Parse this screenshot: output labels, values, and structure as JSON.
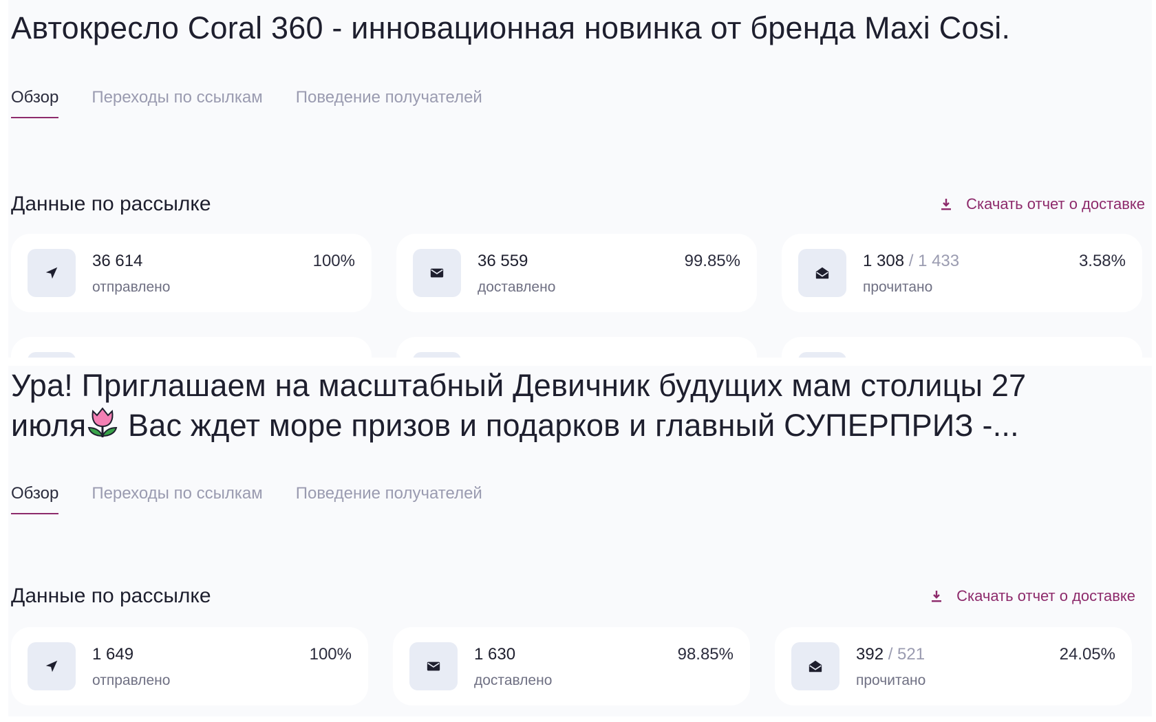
{
  "campaigns": [
    {
      "title_lines": [
        "Автокресло Coral 360 - инновационная новинка от бренда Maxi Cosi."
      ],
      "tabs": [
        "Обзор",
        "Переходы по ссылкам",
        "Поведение получателей"
      ],
      "section_title": "Данные по рассылке",
      "download_label": "Скачать отчет о доставке",
      "stats": [
        {
          "icon": "send-icon",
          "value": "36 614",
          "total": "",
          "caption": "отправлено",
          "percent": "100%"
        },
        {
          "icon": "envelope-icon",
          "value": "36 559",
          "total": "",
          "caption": "доставлено",
          "percent": "99.85%"
        },
        {
          "icon": "envelope-open-icon",
          "value": "1 308",
          "total": "/ 1 433",
          "caption": "прочитано",
          "percent": "3.58%"
        }
      ]
    },
    {
      "title_lines": [
        "Ура! Приглашаем на масштабный Девичник будущих мам столицы 27",
        "июля",
        " Вас ждет море призов и подарков и главный СУПЕРПРИЗ -..."
      ],
      "tabs": [
        "Обзор",
        "Переходы по ссылкам",
        "Поведение получателей"
      ],
      "section_title": "Данные по рассылке",
      "download_label": "Скачать отчет о доставке",
      "stats": [
        {
          "icon": "send-icon",
          "value": "1 649",
          "total": "",
          "caption": "отправлено",
          "percent": "100%"
        },
        {
          "icon": "envelope-icon",
          "value": "1 630",
          "total": "",
          "caption": "доставлено",
          "percent": "98.85%"
        },
        {
          "icon": "envelope-open-icon",
          "value": "392",
          "total": "/ 521",
          "caption": "прочитано",
          "percent": "24.05%"
        }
      ]
    }
  ],
  "colors": {
    "accent": "#8d2a6b",
    "icon_bg": "#e8ecf5",
    "muted": "#9a9bb0",
    "panel_bg": "#f9fafc"
  }
}
